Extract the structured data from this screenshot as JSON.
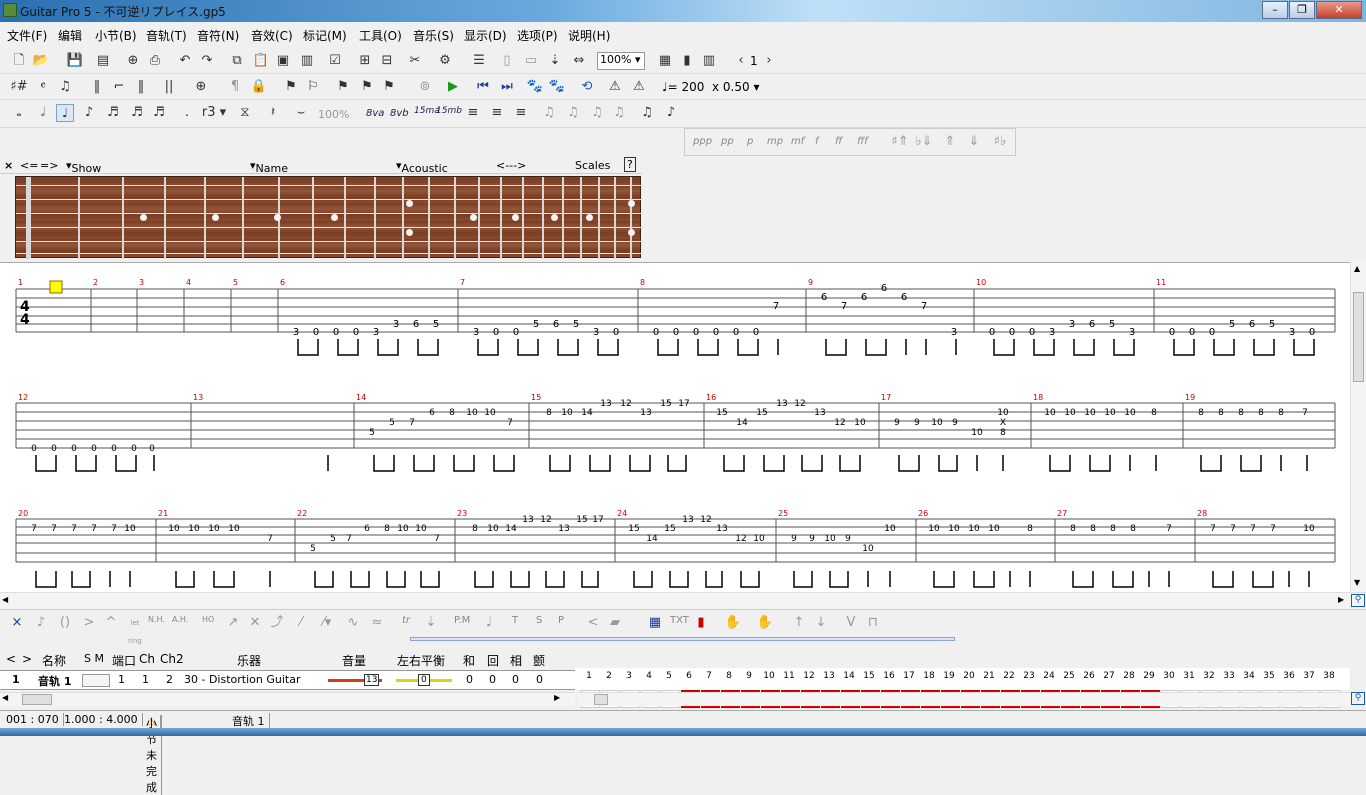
{
  "window": {
    "title": "Guitar Pro 5 - 不可逆リプレイス.gp5",
    "minimize": "–",
    "maximize": "❐",
    "close": "✕"
  },
  "menu": [
    "文件(F)",
    "编辑",
    "小节(B)",
    "音轨(T)",
    "音符(N)",
    "音效(C)",
    "标记(M)",
    "工具(O)",
    "音乐(S)",
    "显示(D)",
    "选项(P)",
    "说明(H)"
  ],
  "toolbar": {
    "zoom": "100%",
    "page": "1",
    "tempo": "= 200",
    "speed": "x 0.50",
    "velocity": "100%",
    "ottava": [
      "8va",
      "8vb",
      "15ma",
      "15mb"
    ],
    "dynamics": [
      "ppp",
      "pp",
      "p",
      "mp",
      "mf",
      "f",
      "ff",
      "fff"
    ]
  },
  "fretboard": {
    "header": [
      "<=",
      "=>",
      "Show [Beat] + [Bar]",
      "Name for [Beat] + [...]",
      "Acoustic",
      "<--->",
      "Scales",
      "?"
    ]
  },
  "score": {
    "measure_numbers": [
      "1",
      "2",
      "3",
      "4",
      "5",
      "6",
      "7",
      "8",
      "9",
      "10",
      "11",
      "12",
      "13",
      "14",
      "15",
      "16",
      "17",
      "18",
      "19",
      "20",
      "21",
      "22",
      "23",
      "24",
      "25",
      "26",
      "27",
      "28"
    ],
    "time_sig": "4/4"
  },
  "tech": {
    "labels": [
      "N.H.",
      "A.H.",
      "HO",
      "P.M",
      "TXT",
      "tr",
      "T",
      "S",
      "P"
    ]
  },
  "tracks": {
    "headers": [
      "名称",
      "S M",
      "端口",
      "Ch",
      "Ch2",
      "乐器",
      "音量",
      "左右平衡",
      "和",
      "回",
      "相",
      "颤"
    ],
    "row": {
      "num": "1",
      "name": "音轨 1",
      "port": "1",
      "ch": "1",
      "ch2": "2",
      "instrument": "30 - Distortion Guitar",
      "volume": "13",
      "pan": "0",
      "chorus": "0",
      "reverb": "0",
      "phaser": "0",
      "tremolo": "0"
    },
    "measure_count": 39,
    "red_from": 6,
    "red_to": 29
  },
  "status": {
    "position": "001 : 070",
    "time": "1.000 : 4.000",
    "warning": "小节未完成",
    "track": "音轨 1"
  },
  "colors": {
    "accent": "#ee0000",
    "fret": "#7a3d24",
    "marker": "#ffff00"
  }
}
